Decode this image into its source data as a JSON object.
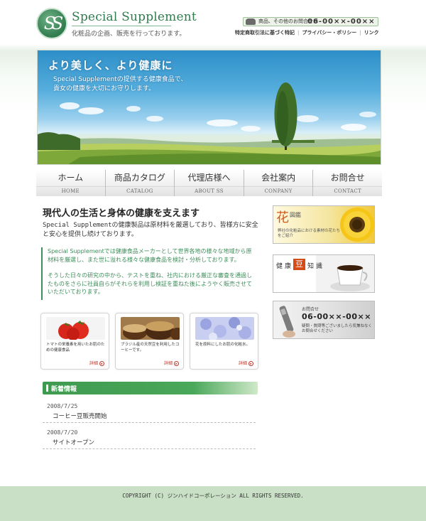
{
  "header": {
    "logo_mark": "SS",
    "logo_title": "Special Supplement",
    "logo_subtitle": "化粧品の企画、販売を行っております。",
    "phone_label": "商品、その他のお問合せは",
    "phone_number": "06-00××-00××",
    "links": [
      "特定商取引法に基づく特記",
      "プライバシー・ポリシー",
      "リンク"
    ]
  },
  "hero": {
    "title": "より美しく、より健康に",
    "text_line1": "Special Supplementの提供する健康食品で、",
    "text_line2": "貴女の健康を大切にお守りします。"
  },
  "nav": [
    {
      "jp": "ホーム",
      "en": "HOME"
    },
    {
      "jp": "商品カタログ",
      "en": "CATALOG"
    },
    {
      "jp": "代理店様へ",
      "en": "ABOUT SS"
    },
    {
      "jp": "会社案内",
      "en": "CONPANY"
    },
    {
      "jp": "お問合せ",
      "en": "CONTACT"
    }
  ],
  "main": {
    "heading": "現代人の生活と身体の健康を支えます",
    "lead": "Special Supplementの健康製品は原材料を厳選しており、皆様方に安全と安心を提供し続けております。",
    "quote_p1": "Special Supplementでは健康食品メーカーとして世界各地の様々な地域から原材料を厳選し、また世に溢れる様々な健康食品を検討・分析しております。",
    "quote_p2": "そうした日々の研究の中から、テストを重ね、社内における厳正な審査を通過したものをさらに社員自らがそれらを利用し検証を重ねた後にようやく販売させていただいております。"
  },
  "cards": [
    {
      "text": "トマトの栄養素を用いたお肌のための健康食品",
      "more": "詳細"
    },
    {
      "text": "ブラジル産の天然豆を利用したコーヒーです。",
      "more": "詳細"
    },
    {
      "text": "花を原料にしたお肌の化粧水。",
      "more": "詳細"
    }
  ],
  "news": {
    "heading": "新着情報",
    "items": [
      {
        "date": "2008/7/25",
        "title": "コーヒー豆販売開始"
      },
      {
        "date": "2008/7/20",
        "title": "サイトオープン"
      }
    ]
  },
  "banners": {
    "flower": {
      "big": "花",
      "label": "図鑑",
      "text": "弊社の化粧品における素材の花たちをご紹介"
    },
    "bean": {
      "w1": "健",
      "w2": "康",
      "mame": "豆",
      "w3": "知",
      "w4": "識"
    },
    "contact": {
      "label": "お問合せ",
      "number": "06-00××-00××",
      "text": "疑問・質問等ございましたら気兼ねなくお問合せください"
    }
  },
  "footer": {
    "copyright": "COPYRIGHT (C) ジンハイドコーポレーション ALL RIGHTS RESERVED."
  },
  "colors": {
    "brand_green": "#2f7c4d",
    "news_green": "#3f9a4f",
    "footer_bg": "#c9dfc6",
    "accent_red": "#c0392b"
  }
}
